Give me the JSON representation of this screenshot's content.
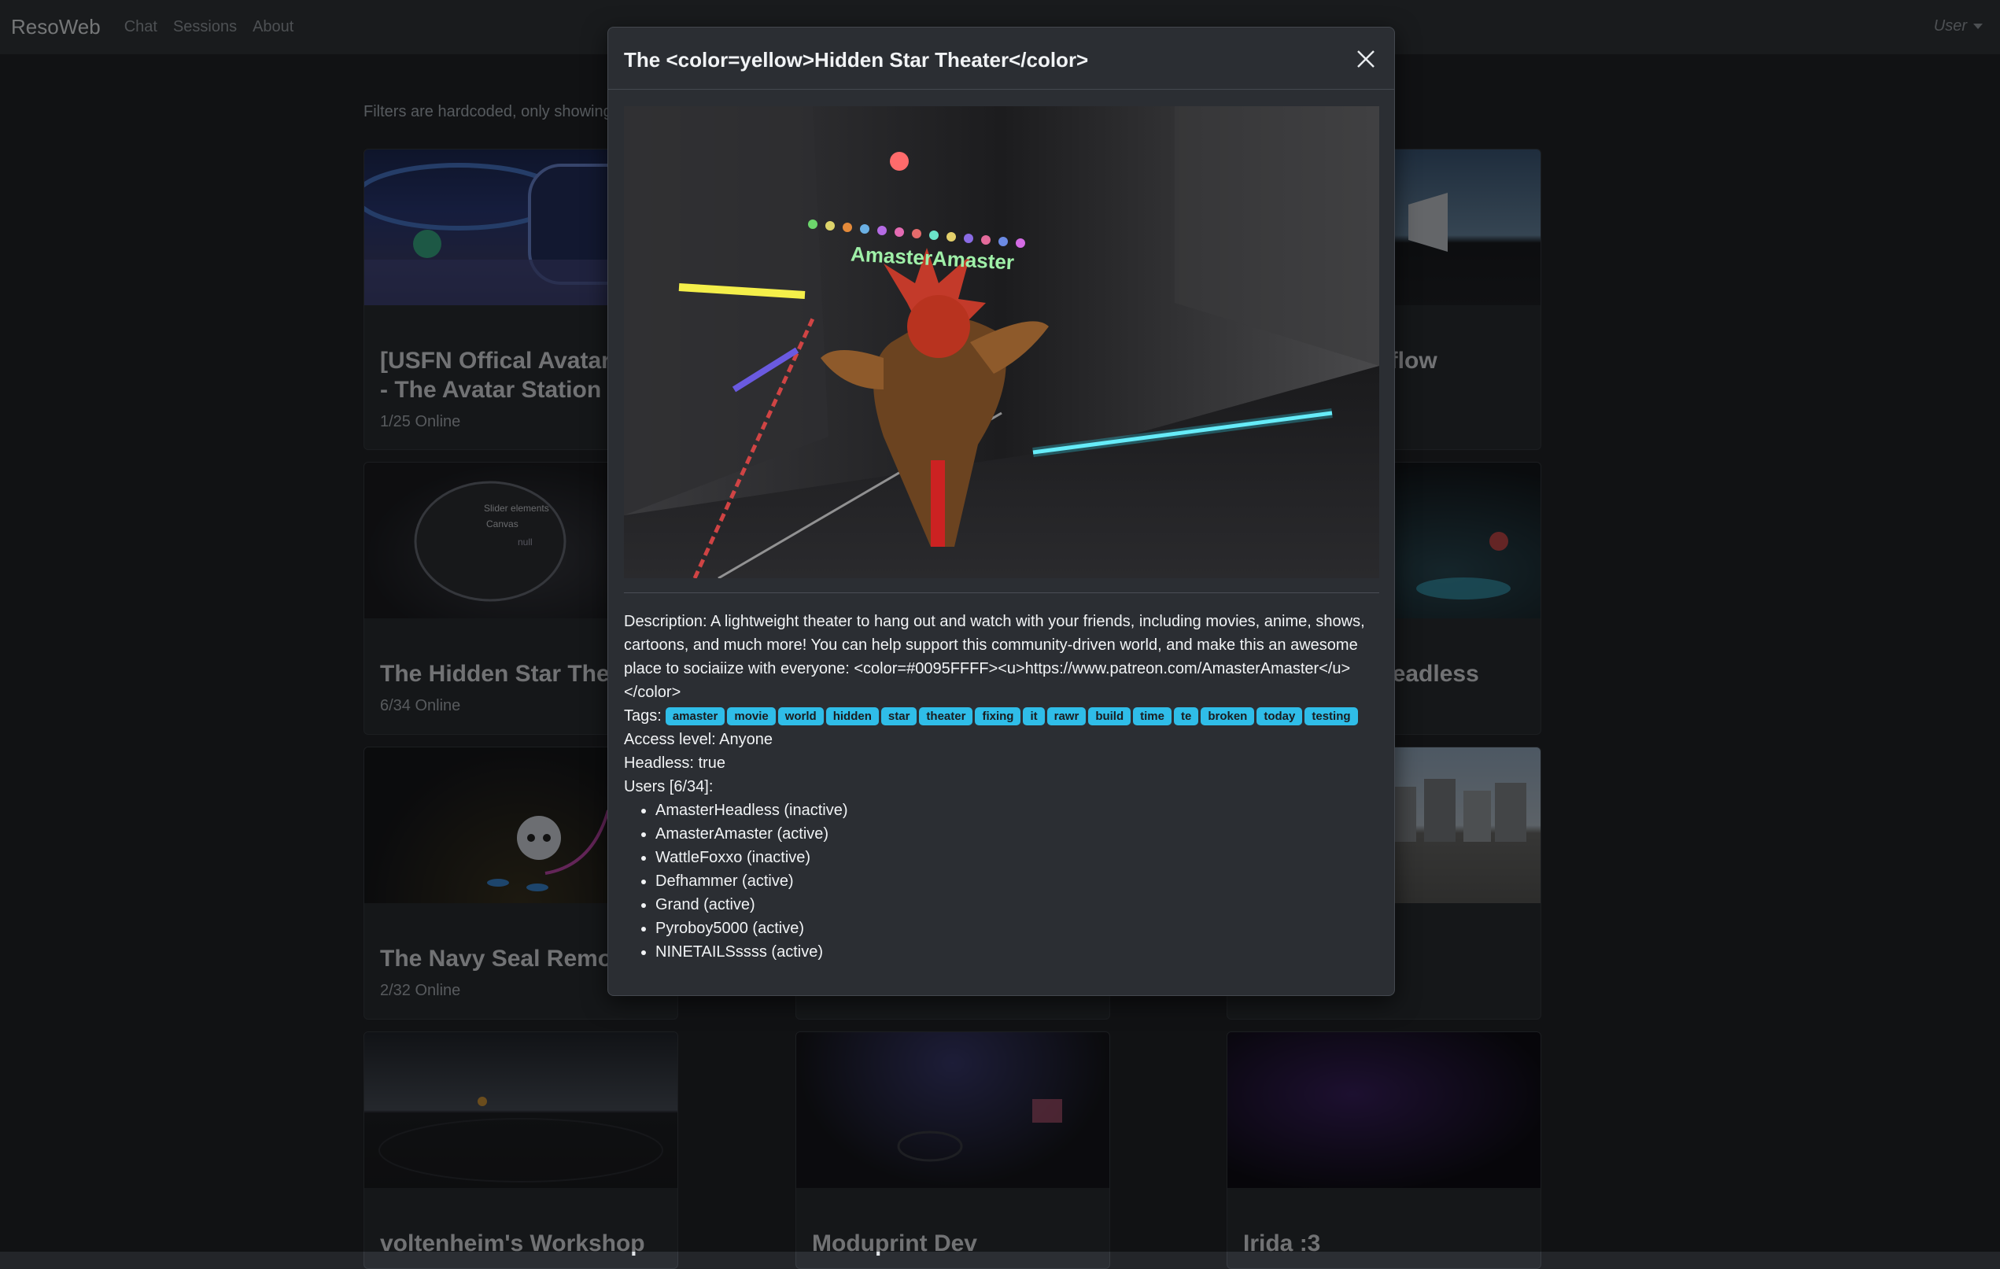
{
  "nav": {
    "brand": "ResoWeb",
    "links": [
      "Chat",
      "Sessions",
      "About"
    ],
    "user": "User"
  },
  "filters_text": "Filters are hardcoded, only showing",
  "cards": [
    {
      "title": "[USFN Offical Avatar I",
      "title2": "- The Avatar Station v",
      "online": "1/25 Online"
    },
    {
      "title": "kflow",
      "online": ""
    },
    {
      "title": "The Hidden Star Thea",
      "online": "6/34 Online"
    },
    {
      "title": "Headless",
      "online": ""
    },
    {
      "title": "The Navy Seal Remod",
      "online": "2/32 Online"
    },
    {
      "title": "voltenheim's Workshop",
      "online": ""
    },
    {
      "title": "Moduprint Dev",
      "online": ""
    },
    {
      "title": "Irida :3",
      "online": ""
    }
  ],
  "modal": {
    "title": "The <color=yellow>Hidden Star Theater</color>",
    "image_label": "AmasterAmaster",
    "description": "Description: A lightweight theater to hang out and watch with your friends, including movies, anime, shows, cartoons, and much more! You can help support this community-driven world, and make this an awesome place to sociaiize with everyone: <color=#0095FFFF><u>https://www.patreon.com/AmasterAmaster</u></color>",
    "tags_label": "Tags:",
    "tags": [
      "amaster",
      "movie",
      "world",
      "hidden",
      "star",
      "theater",
      "fixing",
      "it",
      "rawr",
      "build",
      "time",
      "te",
      "broken",
      "today",
      "testing"
    ],
    "access_level": "Access level: Anyone",
    "headless": "Headless: true",
    "users_label": "Users [6/34]:",
    "users": [
      "AmasterHeadless (inactive)",
      "AmasterAmaster (active)",
      "WattleFoxxo (inactive)",
      "Defhammer (active)",
      "Grand (active)",
      "Pyroboy5000 (active)",
      "NINETAILSssss (active)"
    ]
  }
}
